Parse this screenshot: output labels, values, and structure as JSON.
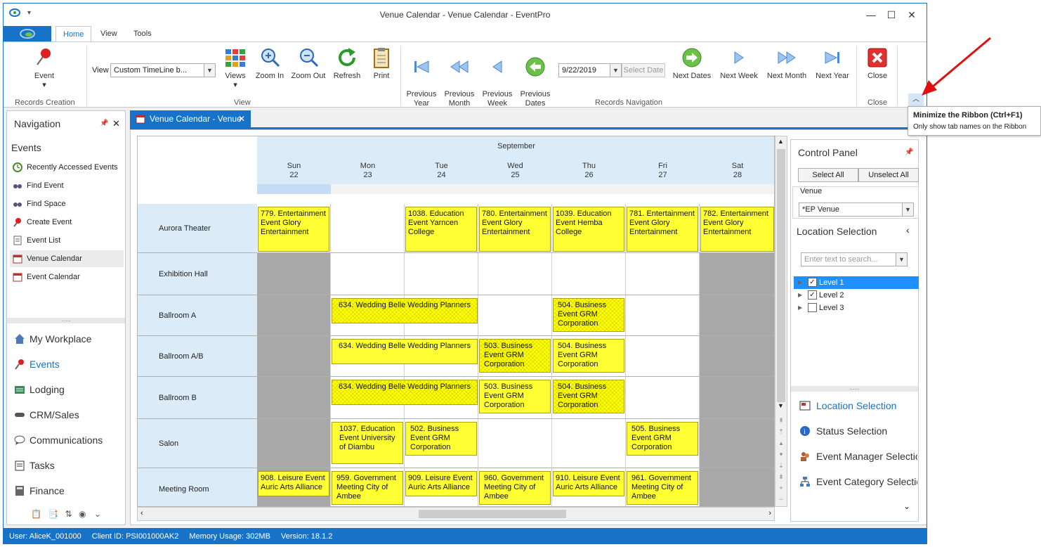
{
  "window": {
    "title": "Venue Calendar - Venue Calendar - EventPro"
  },
  "ribbon_tabs": [
    {
      "label": "Home",
      "active": true
    },
    {
      "label": "View"
    },
    {
      "label": "Tools"
    }
  ],
  "ribbon": {
    "event_label": "Event",
    "records_creation_label": "Records Creation",
    "view_label": "View",
    "view_combo_value": "Custom TimeLine b...",
    "views_label": "Views",
    "zoom_in_label": "Zoom In",
    "zoom_out_label": "Zoom Out",
    "refresh_label": "Refresh",
    "print_label": "Print",
    "view_group_label": "View",
    "prev_year_label": "Previous\nYear",
    "prev_month_label": "Previous\nMonth",
    "prev_week_label": "Previous\nWeek",
    "prev_dates_label": "Previous\nDates",
    "date_value": "9/22/2019",
    "select_date_label": "Select Date",
    "next_dates_label": "Next Dates",
    "next_week_label": "Next Week",
    "next_month_label": "Next Month",
    "next_year_label": "Next Year",
    "records_nav_label": "Records Navigation",
    "close_label": "Close",
    "close_group_label": "Close"
  },
  "tooltip": {
    "title": "Minimize the Ribbon (Ctrl+F1)",
    "text": "Only show tab names on the Ribbon"
  },
  "navigation": {
    "title": "Navigation",
    "section": "Events",
    "items": [
      "Recently Accessed Events",
      "Find Event",
      "Find Space",
      "Create Event",
      "Event List",
      "Venue Calendar",
      "Event Calendar"
    ],
    "modules": [
      "My Workplace",
      "Events",
      "Lodging",
      "CRM/Sales",
      "Communications",
      "Tasks",
      "Finance"
    ]
  },
  "doc_tab": {
    "label": "Venue Calendar - Venue"
  },
  "calendar": {
    "month": "September",
    "days": [
      {
        "dow": "Sun",
        "num": "22"
      },
      {
        "dow": "Mon",
        "num": "23"
      },
      {
        "dow": "Tue",
        "num": "24"
      },
      {
        "dow": "Wed",
        "num": "25"
      },
      {
        "dow": "Thu",
        "num": "26"
      },
      {
        "dow": "Fri",
        "num": "27"
      },
      {
        "dow": "Sat",
        "num": "28"
      }
    ],
    "rooms": [
      "Aurora Theater",
      "Exhibition Hall",
      "Ballroom A",
      "Ballroom A/B",
      "Ballroom B",
      "Salon",
      "Meeting Room"
    ],
    "events": {
      "e779": "779. Entertainment Event Glory Entertainment",
      "e1038": "1038. Education Event Yarncen College",
      "e780": "780. Entertainment Event Glory Entertainment",
      "e1039": "1039. Education Event Hemba College",
      "e781": "781. Entertainment Event Glory Entertainment",
      "e782": "782. Entertainment Event Glory Entertainment",
      "e634a": "634. Wedding Belle Wedding Planners",
      "e504a": "504. Business Event GRM Corporation",
      "e634b": "634. Wedding Belle Wedding Planners",
      "e503b": "503. Business Event GRM Corporation",
      "e504b": "504. Business Event GRM Corporation",
      "e634c": "634. Wedding Belle Wedding Planners",
      "e503c": "503. Business Event GRM Corporation",
      "e504c": "504. Business Event GRM Corporation",
      "e1037": "1037. Education Event University of Diambu",
      "e502": "502. Business Event GRM Corporation",
      "e505": "505. Business Event GRM Corporation",
      "e908": "908. Leisure Event Auric Arts Alliance",
      "e959": "959. Government Meeting City of Ambee",
      "e909": "909. Leisure Event Auric Arts Alliance",
      "e960": "960. Government Meeting City of Ambee",
      "e910": "910. Leisure Event Auric Arts Alliance",
      "e961": "961. Government Meeting City of Ambee"
    }
  },
  "control_panel": {
    "title": "Control Panel",
    "select_all": "Select All",
    "unselect_all": "Unselect All",
    "venue_label": "Venue",
    "venue_value": "*EP Venue",
    "location_selection": "Location Selection",
    "search_placeholder": "Enter text to search...",
    "levels": [
      {
        "label": "Level 1",
        "checked": true
      },
      {
        "label": "Level 2",
        "checked": true
      },
      {
        "label": "Level 3",
        "checked": false
      }
    ],
    "panels": [
      "Location Selection",
      "Status Selection",
      "Event Manager Selectio",
      "Event Category Selectio"
    ]
  },
  "status_bar": {
    "user": "User: AliceK_001000",
    "client": "Client ID: PSI001000AK2",
    "memory": "Memory Usage: 302MB",
    "version": "Version: 18.1.2"
  },
  "colors": {
    "accent": "#1673c8",
    "event": "#ffff33",
    "header": "#dcebf8",
    "blocked": "#a8a8a8"
  }
}
